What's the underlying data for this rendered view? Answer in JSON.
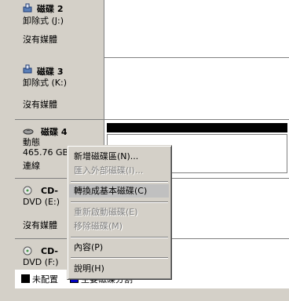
{
  "disks": [
    {
      "name": "磁碟 2",
      "line1": "卸除式 (J:)",
      "line2": "沒有媒體",
      "icon": "removable-disk-icon"
    },
    {
      "name": "磁碟 3",
      "line1": "卸除式 (K:)",
      "line2": "沒有媒體",
      "icon": "removable-disk-icon"
    },
    {
      "name": "磁碟 4",
      "line1": "動態",
      "line2": "465.76 GB",
      "line3": "連線",
      "icon": "hard-disk-icon"
    },
    {
      "name": "CD-",
      "line1": "DVD (E:)",
      "line2": "沒有媒體",
      "icon": "cdrom-icon"
    },
    {
      "name": "CD-",
      "line1": "DVD (F:)",
      "icon": "cdrom-icon"
    }
  ],
  "context_menu": {
    "items": [
      {
        "label": "新增磁碟區(N)...",
        "enabled": true
      },
      {
        "label": "匯入外部磁碟(I)...",
        "enabled": false
      },
      {
        "label": "轉換成基本磁碟(C)",
        "enabled": true,
        "highlighted": true
      },
      {
        "label": "重新啟動磁碟(E)",
        "enabled": false
      },
      {
        "label": "移除磁碟(M)",
        "enabled": false
      },
      {
        "label": "內容(P)",
        "enabled": true
      },
      {
        "label": "說明(H)",
        "enabled": true
      }
    ]
  },
  "legend": {
    "unallocated_label": "未配置",
    "primary_label": "主要磁碟分割",
    "colors": {
      "unallocated": "#000000",
      "primary": "#0000c0"
    }
  }
}
